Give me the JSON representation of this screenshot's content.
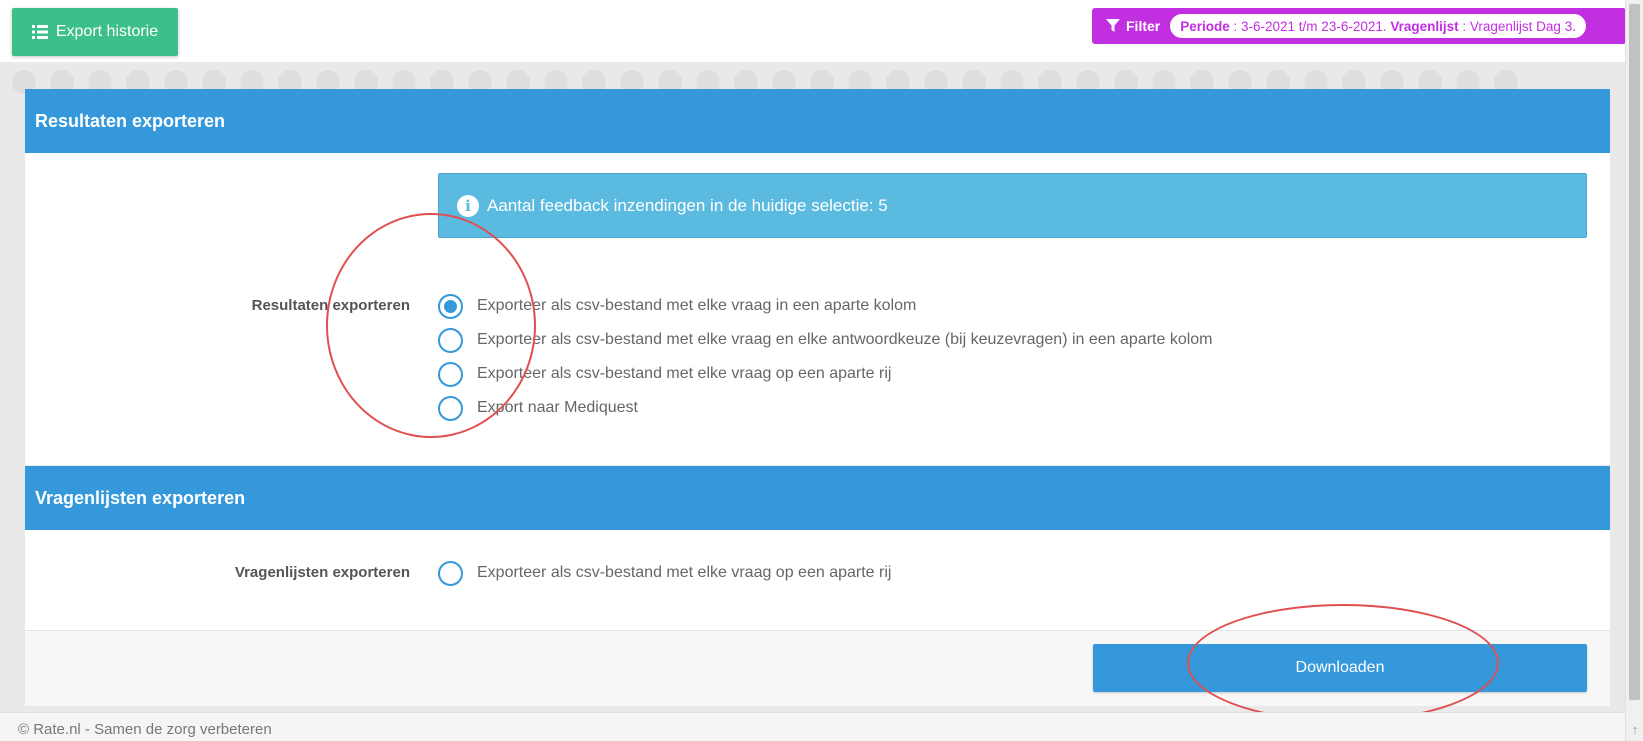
{
  "topbar": {
    "export_history_label": "Export historie",
    "filter": {
      "label": "Filter",
      "period_key": "Periode",
      "period_value": " : 3-6-2021 t/m 23-6-2021. ",
      "questionnaire_key": "Vragenlijst",
      "questionnaire_value": " : Vragenlijst Dag 3."
    }
  },
  "results_panel": {
    "title": "Resultaten exporteren",
    "info_text": "Aantal feedback inzendingen in de huidige selectie: 5",
    "form_label": "Resultaten exporteren",
    "options": [
      {
        "label": "Exporteer als csv-bestand met elke vraag in een aparte kolom",
        "checked": true
      },
      {
        "label": "Exporteer als csv-bestand met elke vraag en elke antwoordkeuze (bij keuzevragen) in een aparte kolom",
        "checked": false
      },
      {
        "label": "Exporteer als csv-bestand met elke vraag op een aparte rij",
        "checked": false
      },
      {
        "label": "Export naar Mediquest",
        "checked": false
      }
    ]
  },
  "questionnaires_panel": {
    "title": "Vragenlijsten exporteren",
    "form_label": "Vragenlijsten exporteren",
    "options": [
      {
        "label": "Exporteer als csv-bestand met elke vraag op een aparte rij",
        "checked": false
      }
    ],
    "download_label": "Downloaden"
  },
  "footer": {
    "text": "© Rate.nl - Samen de zorg verbeteren"
  },
  "colors": {
    "primary": "#3498db",
    "success": "#3dbf8a",
    "filter": "#c22fe0",
    "info": "#5bbadf",
    "annotation": "#e05050"
  }
}
